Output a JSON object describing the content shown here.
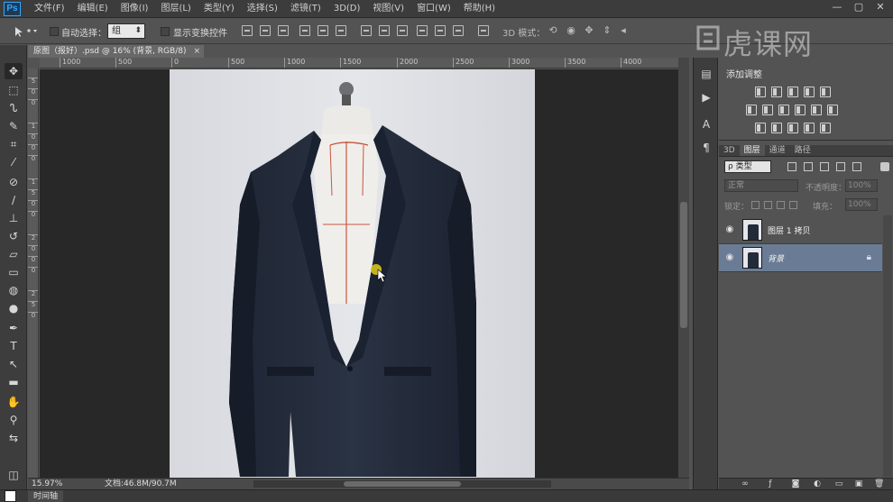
{
  "app": {
    "logo": "Ps"
  },
  "menu": [
    "文件(F)",
    "编辑(E)",
    "图像(I)",
    "图层(L)",
    "类型(Y)",
    "选择(S)",
    "滤镜(T)",
    "3D(D)",
    "视图(V)",
    "窗口(W)",
    "帮助(H)"
  ],
  "window_controls": [
    "—",
    "▢",
    "✕"
  ],
  "options": {
    "auto_select_label": "自动选择：",
    "auto_select_value": "组",
    "show_transform_label": "显示变换控件",
    "mode3d_label": "3D 模式："
  },
  "doc_tab": {
    "title": "原图（报好）.psd @ 16% (背景, RGB/8)",
    "close": "×"
  },
  "rulers": {
    "h_ticks": [
      "1000",
      "500",
      "0",
      "500",
      "1000",
      "1500",
      "2000",
      "2500",
      "3000",
      "3500",
      "4000"
    ],
    "v_ticks": [
      "5",
      "0",
      "0",
      "1",
      "0",
      "0",
      "0",
      "1",
      "5",
      "0",
      "0",
      "2",
      "0",
      "0",
      "0",
      "2",
      "5",
      "0"
    ]
  },
  "status": {
    "zoom": "15.97%",
    "doc_info": "文档:46.8M/90.7M"
  },
  "timeline_tab": "时间轴",
  "watermark": "虎课网",
  "adjustments": {
    "title": "添加调整"
  },
  "layer_tabs": [
    "3D",
    "图层",
    "通道",
    "路径"
  ],
  "layers_panel": {
    "filter_kind": "ρ 类型",
    "blend_mode": "正常",
    "opacity_label": "不透明度：",
    "opacity_value": "100%",
    "lock_label": "锁定：",
    "fill_label": "填充：",
    "fill_value": "100%"
  },
  "layers": [
    {
      "name": "图层 1 拷贝",
      "selected": false,
      "locked": false
    },
    {
      "name": "背景",
      "selected": true,
      "locked": true
    }
  ],
  "colors": {
    "foreground": "#ffffff",
    "background": "#e8c76a",
    "selection": "#6a7c95",
    "jacket": "#242c3c"
  },
  "icons": {
    "eye": "eye-icon",
    "lock": "lock-icon"
  }
}
